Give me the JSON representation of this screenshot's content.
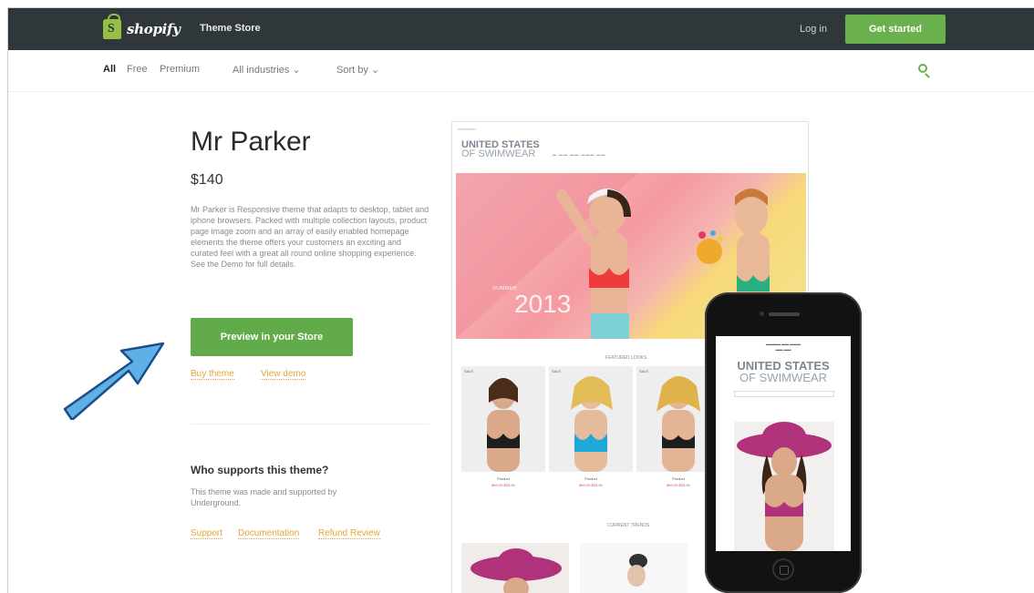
{
  "header": {
    "brand": "shopify",
    "store_link": "Theme Store",
    "login": "Log in",
    "cta": "Get started"
  },
  "filters": {
    "items": [
      "All",
      "Free",
      "Premium",
      "All industries ⌄",
      "Sort by ⌄"
    ]
  },
  "theme": {
    "title": "Mr Parker",
    "price": "$140",
    "description": "Mr Parker is Responsive theme that adapts to desktop, tablet and iphone browsers. Packed with multiple collection layouts, product page image zoom and an array of easily enabled homepage elements the theme offers your customers an exciting and curated feel with a great all round online shopping experience. See the Demo for full details.",
    "preview_button": "Preview in your Store",
    "buy_link": "Buy theme",
    "demo_link": "View demo"
  },
  "support": {
    "title": "Who supports this theme?",
    "text": "This theme was made and supported by Underground.",
    "links": [
      "Support",
      "Documentation",
      "Refund Review"
    ]
  },
  "mockup": {
    "brand_line1": "UNITED STATES",
    "brand_line2": "OF SWIMWEAR",
    "hero_year": "2013",
    "hero_small": "SUMMER",
    "featured_label": "FEATURED LOOKS",
    "popular_label": "CURRENT TRENDS",
    "product_tag": "SALE",
    "product_name": "Product",
    "product_price": "$40.00 $20.00"
  },
  "colors": {
    "topbar": "#30373b",
    "accent_green": "#62ab4a",
    "link_orange": "#e8a33a",
    "arrow_blue": "#5fb0e6"
  }
}
